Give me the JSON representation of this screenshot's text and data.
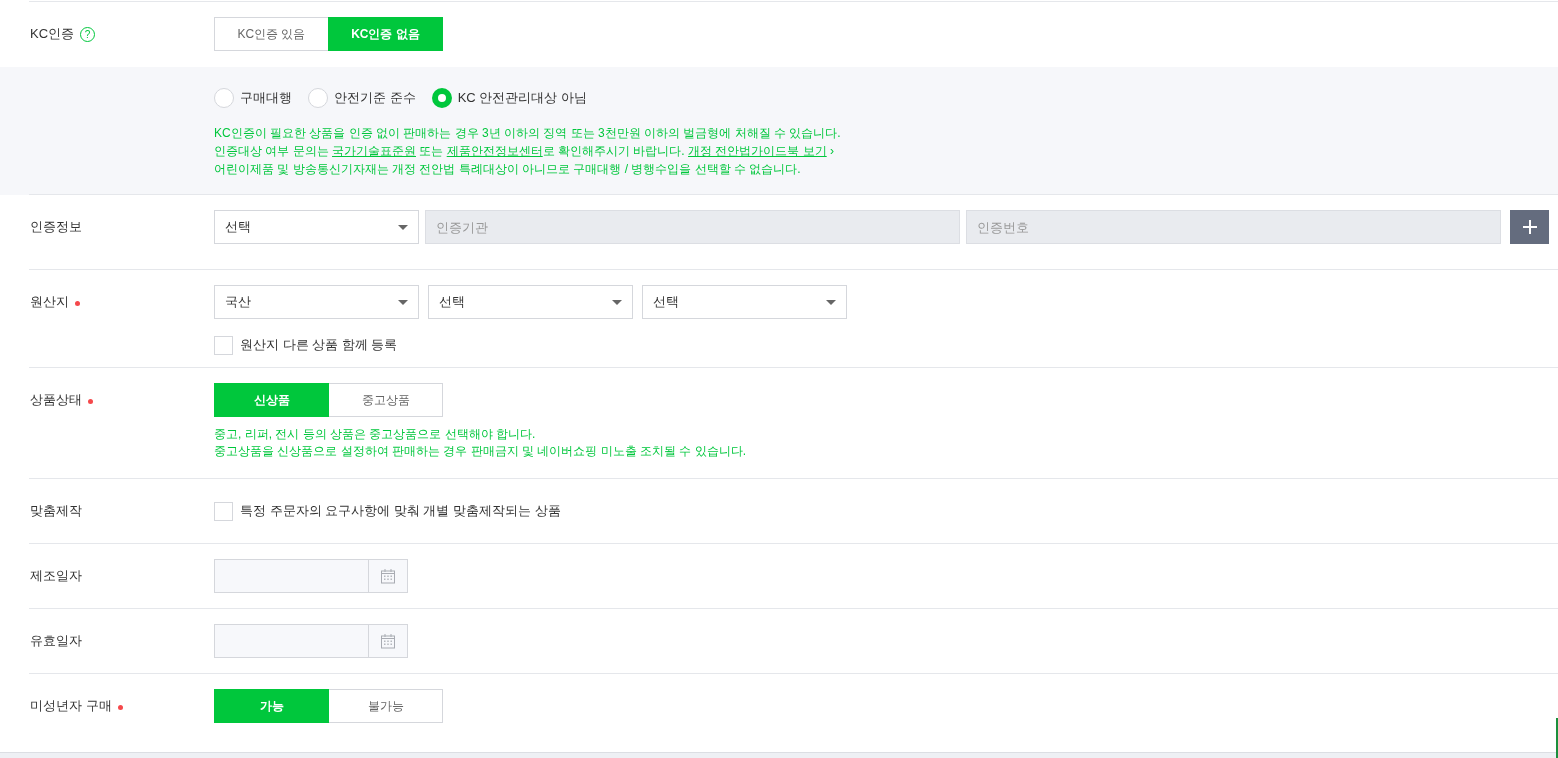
{
  "rows": [
    {
      "kind": "segmented",
      "label": "KC인증",
      "help": "?",
      "required": false,
      "options": [
        {
          "label": "KC인증 있음",
          "selected": false
        },
        {
          "label": "KC인증 없음",
          "selected": true
        }
      ],
      "panel": {
        "radios": [
          {
            "label": "구매대행",
            "selected": false
          },
          {
            "label": "안전기준 준수",
            "selected": false
          },
          {
            "label": "KC 안전관리대상 아님",
            "selected": true
          }
        ],
        "notes": [
          {
            "parts": [
              {
                "kind": "text",
                "text": "KC인증이 필요한 상품을 인증 없이 판매하는 경우 3년 이하의 징역 또는 3천만원 이하의 벌금형에 처해질 수 있습니다."
              }
            ]
          },
          {
            "parts": [
              {
                "kind": "text",
                "text": "인증대상 여부 문의는 "
              },
              {
                "kind": "link",
                "text": "국가기술표준원"
              },
              {
                "kind": "text",
                "text": " 또는 "
              },
              {
                "kind": "link",
                "text": "제품안전정보센터"
              },
              {
                "kind": "text",
                "text": "로 확인해주시기 바랍니다. "
              },
              {
                "kind": "link",
                "text": "개정 전안법가이드북 보기"
              },
              {
                "kind": "text",
                "text": " ›"
              }
            ]
          },
          {
            "parts": [
              {
                "kind": "text",
                "text": "어린이제품 및 방송통신기자재는 개정 전안법 특례대상이 아니므로 구매대행 / 병행수입을 선택할 수 없습니다."
              }
            ]
          }
        ]
      }
    },
    {
      "kind": "cert_info",
      "label": "인증정보",
      "required": false,
      "select": "선택",
      "inputs": [
        {
          "placeholder": "인증기관",
          "disabled": true
        },
        {
          "placeholder": "인증번호",
          "disabled": true
        }
      ]
    },
    {
      "kind": "origin",
      "label": "원산지",
      "required": true,
      "selects": [
        "국산",
        "선택",
        "선택"
      ],
      "checkbox": {
        "label": "원산지 다른 상품 함께 등록",
        "checked": false
      }
    },
    {
      "kind": "segmented",
      "label": "상품상태",
      "required": true,
      "options": [
        {
          "label": "신상품",
          "selected": true
        },
        {
          "label": "중고상품",
          "selected": false
        }
      ],
      "notes": [
        "중고, 리퍼, 전시 등의 상품은 중고상품으로 선택해야 합니다.",
        "중고상품을 신상품으로 설정하여 판매하는 경우 판매금지 및 네이버쇼핑 미노출 조치될 수 있습니다."
      ]
    },
    {
      "kind": "checkbox",
      "label": "맞춤제작",
      "required": false,
      "checkbox": {
        "label": "특정 주문자의 요구사항에 맞춰 개별 맞춤제작되는 상품",
        "checked": false
      }
    },
    {
      "kind": "date",
      "label": "제조일자",
      "required": false
    },
    {
      "kind": "date",
      "label": "유효일자",
      "required": false
    },
    {
      "kind": "segmented",
      "label": "미성년자 구매",
      "required": true,
      "options": [
        {
          "label": "가능",
          "selected": true
        },
        {
          "label": "불가능",
          "selected": false
        }
      ]
    }
  ]
}
